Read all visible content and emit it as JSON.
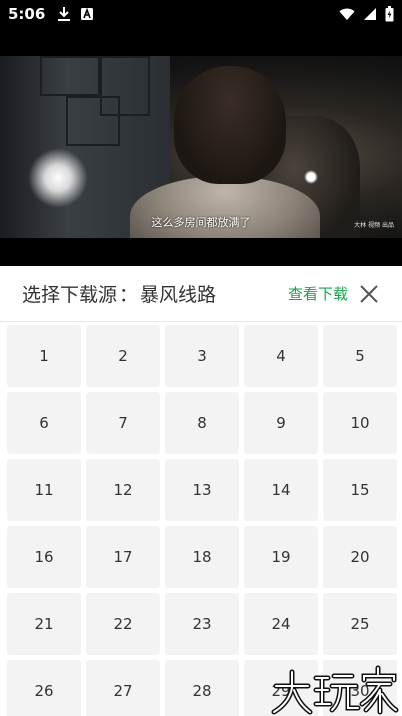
{
  "status_bar": {
    "time": "5:06",
    "left_icons": [
      "download-icon",
      "a-badge-icon"
    ],
    "right_icons": [
      "wifi-icon",
      "signal-icon",
      "battery-icon"
    ]
  },
  "video": {
    "subtitle": "这么多房间都放满了",
    "watermark": "大林 视频 出品"
  },
  "sheet": {
    "title_prefix": "选择下载源",
    "title_separator": "：",
    "source_name": "暴风线路",
    "view_downloads": "查看下载",
    "episodes": [
      "1",
      "2",
      "3",
      "4",
      "5",
      "6",
      "7",
      "8",
      "9",
      "10",
      "11",
      "12",
      "13",
      "14",
      "15",
      "16",
      "17",
      "18",
      "19",
      "20",
      "21",
      "22",
      "23",
      "24",
      "25",
      "26",
      "27",
      "28",
      "29",
      "30"
    ]
  },
  "overlay": {
    "logo_text": "大玩家"
  },
  "colors": {
    "accent_green": "#17a34a",
    "cell_bg": "#f3f3f3",
    "text_dark": "#333333"
  }
}
